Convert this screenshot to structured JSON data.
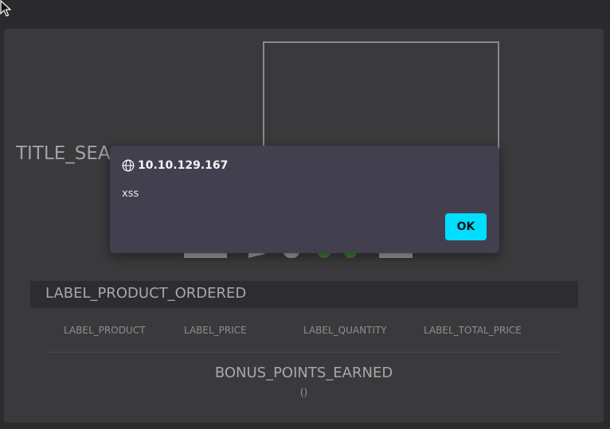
{
  "page": {
    "title_search": "TITLE_SEARCH",
    "section_title": "LABEL_PRODUCT_ORDERED",
    "columns": [
      "LABEL_PRODUCT",
      "LABEL_PRICE",
      "LABEL_QUANTITY",
      "LABEL_TOTAL_PRICE"
    ],
    "bonus_label": "BONUS_POINTS_EARNED",
    "bonus_value": "()"
  },
  "dialog": {
    "origin": "10.10.129.167",
    "message": "xss",
    "ok_label": "OK"
  },
  "icons": {
    "origin": "globe-icon",
    "cursor": "mouse-pointer-icon"
  },
  "colors": {
    "accent": "#00ddff",
    "dialog_bg": "#42404f",
    "page_bg": "#3a3a3c"
  }
}
